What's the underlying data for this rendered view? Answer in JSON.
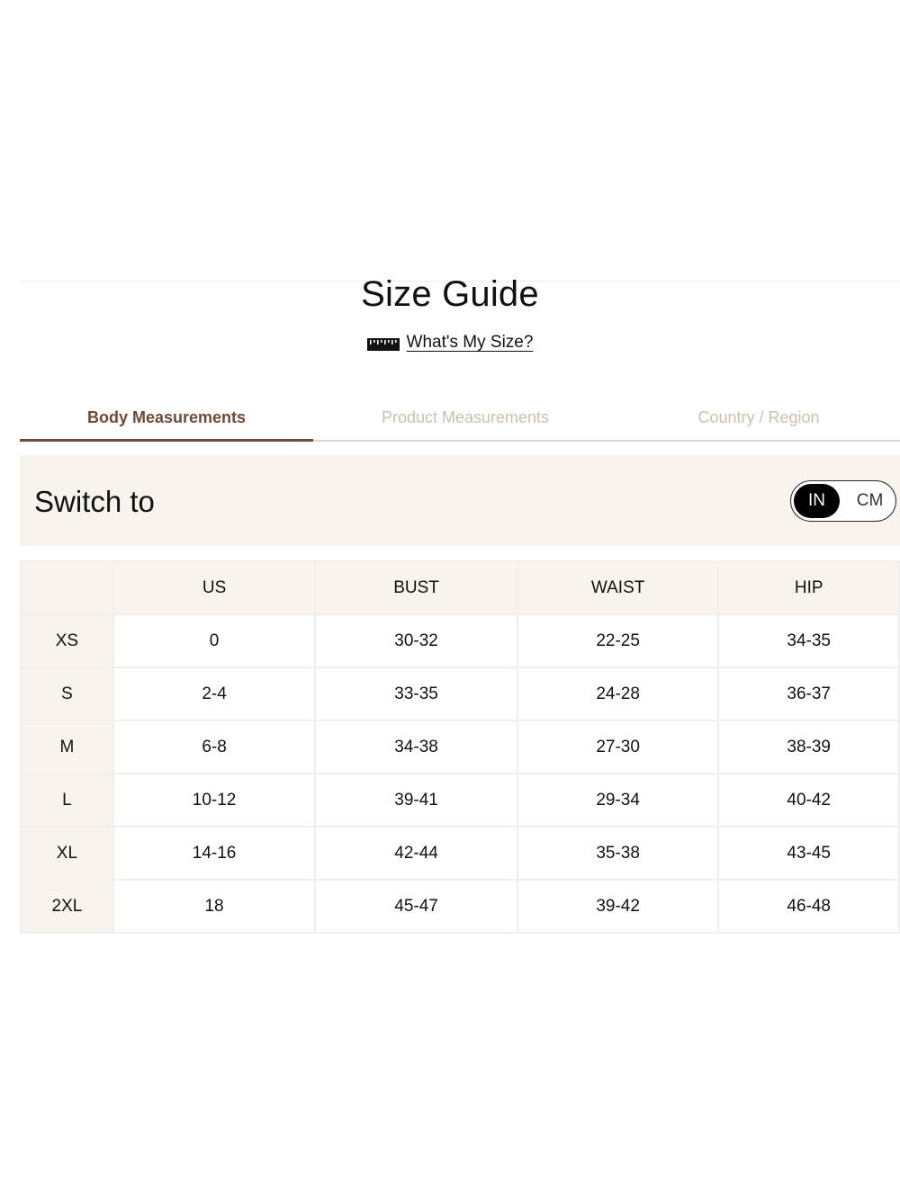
{
  "title": "Size Guide",
  "size_help": {
    "icon": "ruler-icon",
    "label": "What's My Size?"
  },
  "tabs": [
    {
      "label": "Body Measurements",
      "active": true
    },
    {
      "label": "Product Measurements",
      "active": false
    },
    {
      "label": "Country / Region",
      "active": false
    }
  ],
  "switch": {
    "label": "Switch to",
    "options": [
      "IN",
      "CM"
    ],
    "selected": "IN"
  },
  "table": {
    "headers": [
      "",
      "US",
      "BUST",
      "WAIST",
      "HIP"
    ],
    "rows": [
      {
        "size": "XS",
        "us": "0",
        "bust": "30-32",
        "waist": "22-25",
        "hip": "34-35"
      },
      {
        "size": "S",
        "us": "2-4",
        "bust": "33-35",
        "waist": "24-28",
        "hip": "36-37"
      },
      {
        "size": "M",
        "us": "6-8",
        "bust": "34-38",
        "waist": "27-30",
        "hip": "38-39"
      },
      {
        "size": "L",
        "us": "10-12",
        "bust": "39-41",
        "waist": "29-34",
        "hip": "40-42"
      },
      {
        "size": "XL",
        "us": "14-16",
        "bust": "42-44",
        "waist": "35-38",
        "hip": "43-45"
      },
      {
        "size": "2XL",
        "us": "18",
        "bust": "45-47",
        "waist": "39-42",
        "hip": "46-48"
      }
    ]
  },
  "colors": {
    "accent": "#6e4a36",
    "inactive_tab": "#cdbfae",
    "panel_bg": "#f8f3ec"
  }
}
